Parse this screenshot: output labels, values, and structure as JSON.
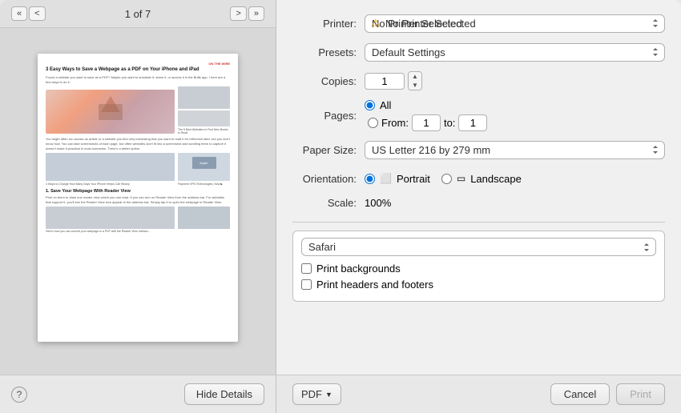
{
  "preview": {
    "page_indicator": "1 of 7",
    "nav": {
      "back_back": "«",
      "back": "<",
      "forward": ">",
      "forward_forward": "»"
    },
    "thumbnail": {
      "title": "3 Easy Ways to Save a Webpage as a PDF on Your iPhone and iPad",
      "body1": "Found a website you want to save as a PDF? Maybe you want to annotate it, share it, or access it in the Buffs app. I here are a few ways to do it.",
      "body2": "You might often run across an article or a website you find very interesting that you want to read it for reference later, but you don't know how. You can take screenshots of each page, but often websites don't fit into a screenshot and scrolling them to capture it doesn't make it practical in most scenarios. There's a better option.",
      "side_title": "ON THE WIRE",
      "section1": "1. Save Your Webpage With Reader View"
    }
  },
  "form": {
    "printer_label": "Printer:",
    "printer_value": "No Printer Selected",
    "presets_label": "Presets:",
    "presets_value": "Default Settings",
    "copies_label": "Copies:",
    "copies_value": "1",
    "pages_label": "Pages:",
    "pages_all": "All",
    "pages_from": "From:",
    "pages_from_value": "1",
    "pages_to": "to:",
    "pages_to_value": "1",
    "paper_size_label": "Paper Size:",
    "paper_size_value": "US Letter  216 by 279 mm",
    "orientation_label": "Orientation:",
    "portrait_label": "Portrait",
    "landscape_label": "Landscape",
    "scale_label": "Scale:",
    "scale_value": "100%",
    "safari_value": "Safari",
    "print_backgrounds_label": "Print backgrounds",
    "print_headers_footers_label": "Print headers and footers"
  },
  "bottom": {
    "help": "?",
    "hide_details": "Hide Details",
    "pdf_label": "PDF",
    "pdf_chevron": "▼",
    "cancel_label": "Cancel",
    "print_label": "Print"
  }
}
